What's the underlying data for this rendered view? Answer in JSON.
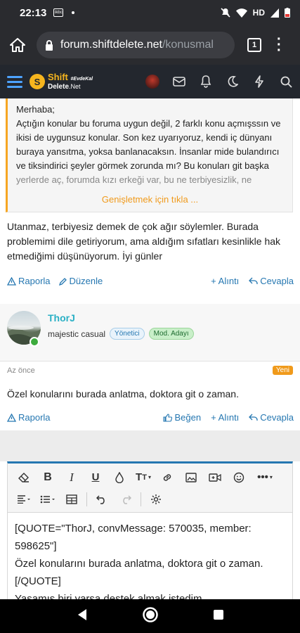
{
  "statusbar": {
    "time": "22:13",
    "notif_label": "ikbc",
    "network": "HD"
  },
  "browser": {
    "host": "forum.shiftdelete.net",
    "path": "/konusmal",
    "tab_count": "1"
  },
  "site": {
    "logo_w1": "Shift",
    "logo_tag": "#EvdeKal",
    "logo_w2": "Delete",
    "logo_w2b": ".Net"
  },
  "quote": {
    "text_visible": "Merhaba;\nAçtığın konular bu foruma uygun değil, 2 farklı konu açmışssın ve ikisi de uygunsuz konular. Son kez uyarıyoruz, kendi iç dünyanı buraya yansıtma, yoksa banlanacaksın. İnsanlar mide bulandırıcı ve tiksindirici şeyler görmek zorunda mı? Bu konuları git başka",
    "text_faded": "yerlerde aç, forumda kızı erkeği var, bu ne terbiyesizlik, ne utanmazlık.",
    "expand_label": "Genişletmek için tıkla ..."
  },
  "post1": {
    "body": "Utanmaz, terbiyesiz demek de çok ağır söylemler. Burada problemimi dile getiriyorum, ama aldığım sıfatları kesinlikle hak etmediğimi düşünüyorum. İyi günler",
    "report_label": "Raporla",
    "edit_label": "Düzenle",
    "quote_label": "Alıntı",
    "reply_label": "Cevapla"
  },
  "post2": {
    "username": "ThorJ",
    "user_title": "majestic casual",
    "badge1": "Yönetici",
    "badge2": "Mod. Adayı",
    "time": "Az önce",
    "new_label": "Yeni",
    "body": "Özel konularını burada anlatma, doktora git o zaman.",
    "report_label": "Raporla",
    "like_label": "Beğen",
    "quote_label": "Alıntı",
    "reply_label": "Cevapla"
  },
  "editor": {
    "line1": "[QUOTE=\"ThorJ, convMessage: 570035, member:",
    "line2": "598625\"]",
    "line3": "Özel konularını burada anlatma, doktora git o zaman.",
    "line4": "[/QUOTE]",
    "line5": "Yaşamış biri varsa destek almak istedim,"
  },
  "colors": {
    "accent": "#2577b1",
    "brand": "#f6b51e",
    "orange": "#f09a1b"
  }
}
